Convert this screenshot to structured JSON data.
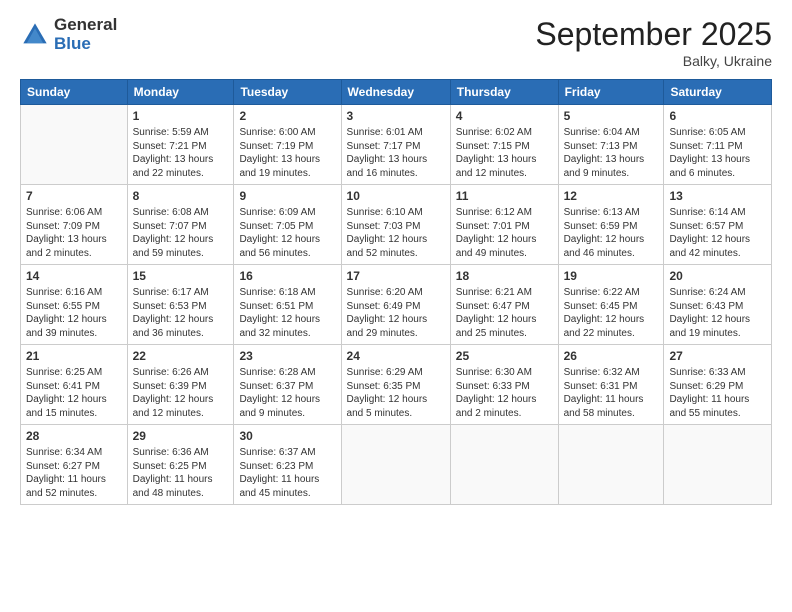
{
  "header": {
    "logo_general": "General",
    "logo_blue": "Blue",
    "month_title": "September 2025",
    "location": "Balky, Ukraine"
  },
  "days_of_week": [
    "Sunday",
    "Monday",
    "Tuesday",
    "Wednesday",
    "Thursday",
    "Friday",
    "Saturday"
  ],
  "weeks": [
    [
      {
        "day": "",
        "info": ""
      },
      {
        "day": "1",
        "info": "Sunrise: 5:59 AM\nSunset: 7:21 PM\nDaylight: 13 hours\nand 22 minutes."
      },
      {
        "day": "2",
        "info": "Sunrise: 6:00 AM\nSunset: 7:19 PM\nDaylight: 13 hours\nand 19 minutes."
      },
      {
        "day": "3",
        "info": "Sunrise: 6:01 AM\nSunset: 7:17 PM\nDaylight: 13 hours\nand 16 minutes."
      },
      {
        "day": "4",
        "info": "Sunrise: 6:02 AM\nSunset: 7:15 PM\nDaylight: 13 hours\nand 12 minutes."
      },
      {
        "day": "5",
        "info": "Sunrise: 6:04 AM\nSunset: 7:13 PM\nDaylight: 13 hours\nand 9 minutes."
      },
      {
        "day": "6",
        "info": "Sunrise: 6:05 AM\nSunset: 7:11 PM\nDaylight: 13 hours\nand 6 minutes."
      }
    ],
    [
      {
        "day": "7",
        "info": "Sunrise: 6:06 AM\nSunset: 7:09 PM\nDaylight: 13 hours\nand 2 minutes."
      },
      {
        "day": "8",
        "info": "Sunrise: 6:08 AM\nSunset: 7:07 PM\nDaylight: 12 hours\nand 59 minutes."
      },
      {
        "day": "9",
        "info": "Sunrise: 6:09 AM\nSunset: 7:05 PM\nDaylight: 12 hours\nand 56 minutes."
      },
      {
        "day": "10",
        "info": "Sunrise: 6:10 AM\nSunset: 7:03 PM\nDaylight: 12 hours\nand 52 minutes."
      },
      {
        "day": "11",
        "info": "Sunrise: 6:12 AM\nSunset: 7:01 PM\nDaylight: 12 hours\nand 49 minutes."
      },
      {
        "day": "12",
        "info": "Sunrise: 6:13 AM\nSunset: 6:59 PM\nDaylight: 12 hours\nand 46 minutes."
      },
      {
        "day": "13",
        "info": "Sunrise: 6:14 AM\nSunset: 6:57 PM\nDaylight: 12 hours\nand 42 minutes."
      }
    ],
    [
      {
        "day": "14",
        "info": "Sunrise: 6:16 AM\nSunset: 6:55 PM\nDaylight: 12 hours\nand 39 minutes."
      },
      {
        "day": "15",
        "info": "Sunrise: 6:17 AM\nSunset: 6:53 PM\nDaylight: 12 hours\nand 36 minutes."
      },
      {
        "day": "16",
        "info": "Sunrise: 6:18 AM\nSunset: 6:51 PM\nDaylight: 12 hours\nand 32 minutes."
      },
      {
        "day": "17",
        "info": "Sunrise: 6:20 AM\nSunset: 6:49 PM\nDaylight: 12 hours\nand 29 minutes."
      },
      {
        "day": "18",
        "info": "Sunrise: 6:21 AM\nSunset: 6:47 PM\nDaylight: 12 hours\nand 25 minutes."
      },
      {
        "day": "19",
        "info": "Sunrise: 6:22 AM\nSunset: 6:45 PM\nDaylight: 12 hours\nand 22 minutes."
      },
      {
        "day": "20",
        "info": "Sunrise: 6:24 AM\nSunset: 6:43 PM\nDaylight: 12 hours\nand 19 minutes."
      }
    ],
    [
      {
        "day": "21",
        "info": "Sunrise: 6:25 AM\nSunset: 6:41 PM\nDaylight: 12 hours\nand 15 minutes."
      },
      {
        "day": "22",
        "info": "Sunrise: 6:26 AM\nSunset: 6:39 PM\nDaylight: 12 hours\nand 12 minutes."
      },
      {
        "day": "23",
        "info": "Sunrise: 6:28 AM\nSunset: 6:37 PM\nDaylight: 12 hours\nand 9 minutes."
      },
      {
        "day": "24",
        "info": "Sunrise: 6:29 AM\nSunset: 6:35 PM\nDaylight: 12 hours\nand 5 minutes."
      },
      {
        "day": "25",
        "info": "Sunrise: 6:30 AM\nSunset: 6:33 PM\nDaylight: 12 hours\nand 2 minutes."
      },
      {
        "day": "26",
        "info": "Sunrise: 6:32 AM\nSunset: 6:31 PM\nDaylight: 11 hours\nand 58 minutes."
      },
      {
        "day": "27",
        "info": "Sunrise: 6:33 AM\nSunset: 6:29 PM\nDaylight: 11 hours\nand 55 minutes."
      }
    ],
    [
      {
        "day": "28",
        "info": "Sunrise: 6:34 AM\nSunset: 6:27 PM\nDaylight: 11 hours\nand 52 minutes."
      },
      {
        "day": "29",
        "info": "Sunrise: 6:36 AM\nSunset: 6:25 PM\nDaylight: 11 hours\nand 48 minutes."
      },
      {
        "day": "30",
        "info": "Sunrise: 6:37 AM\nSunset: 6:23 PM\nDaylight: 11 hours\nand 45 minutes."
      },
      {
        "day": "",
        "info": ""
      },
      {
        "day": "",
        "info": ""
      },
      {
        "day": "",
        "info": ""
      },
      {
        "day": "",
        "info": ""
      }
    ]
  ]
}
